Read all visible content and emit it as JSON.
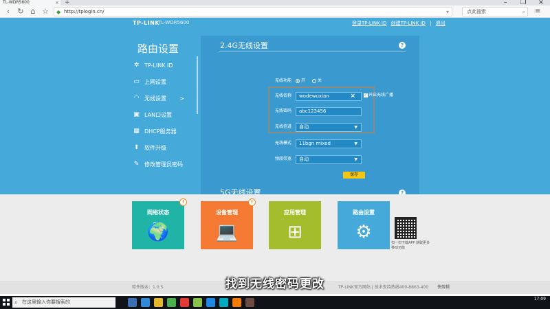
{
  "browser": {
    "tab_title": "TL-WDR5600",
    "tab_close": "×",
    "new_tab": "+",
    "url": "http://tplogin.cn/",
    "search_placeholder": "点此搜索",
    "window": {
      "min": "–",
      "max": "❐",
      "close": "×"
    }
  },
  "router": {
    "brand": "TP-LINK",
    "model": "TL-WDR5600",
    "top_links": [
      "登录TP-LINK ID",
      "创建TP-LINK ID",
      "|",
      "退出"
    ],
    "sidebar_title": "路由设置",
    "sidebar_items": [
      {
        "label": "TP-LINK ID",
        "icon": "gear-icon",
        "glyph": "✲"
      },
      {
        "label": "上网设置",
        "icon": "laptop-icon",
        "glyph": "▭"
      },
      {
        "label": "无线设置",
        "icon": "wifi-icon",
        "glyph": "◠",
        "arrow": ">"
      },
      {
        "label": "LAN口设置",
        "icon": "lan-icon",
        "glyph": "▣"
      },
      {
        "label": "DHCP服务器",
        "icon": "dhcp-icon",
        "glyph": "▦"
      },
      {
        "label": "软件升级",
        "icon": "upgrade-icon",
        "glyph": "⬆"
      },
      {
        "label": "修改管理员密码",
        "icon": "pencil-icon",
        "glyph": "✎"
      }
    ],
    "wifi24": {
      "section_title": "2.4G无线设置",
      "help": "?",
      "function_label": "无线功能",
      "on_label": "开",
      "off_label": "关",
      "name_label": "无线名称",
      "name_value": "wodewuxian",
      "clear": "×",
      "broadcast_label": "开启无线广播",
      "broadcast_check": "✓",
      "password_label": "无线密码",
      "password_value": "abc123456",
      "channel_label": "无线信道",
      "channel_value": "自动",
      "mode_label": "无线模式",
      "mode_value": "11bgn mixed",
      "bandwidth_label": "频段带宽",
      "bandwidth_value": "自动",
      "caret": "▼",
      "save_label": "保存"
    },
    "wifi5": {
      "section_title": "5G无线设置",
      "help": "?"
    }
  },
  "tiles": [
    {
      "label": "网络状态",
      "glyph": "🌍",
      "color": "#1fb4a6",
      "badge": "!"
    },
    {
      "label": "设备管理",
      "glyph": "💻",
      "color": "#f47a33",
      "badge": "!"
    },
    {
      "label": "应用管理",
      "glyph": "⊞",
      "color": "#a4bd2c"
    },
    {
      "label": "路由设置",
      "glyph": "⚙",
      "color": "#45a9d9"
    }
  ],
  "qr_caption": "扫一扫下载APP 获取更多移动功能",
  "footer": {
    "version": "软件版本：1.0.5",
    "site": "TP-LINK官方网站  |  技术支持热线400-8863-400",
    "tray": "快剪辑"
  },
  "subtitle": "找到无线密码更改",
  "taskbar": {
    "search_placeholder": "在这里输入你要搜索的",
    "time": "17:09"
  },
  "colors": {
    "router_blue": "#45a9d9",
    "panel_blue": "#3a9ad0",
    "save_yellow": "#f3c514",
    "highlight_border": "#8e8a7e"
  }
}
